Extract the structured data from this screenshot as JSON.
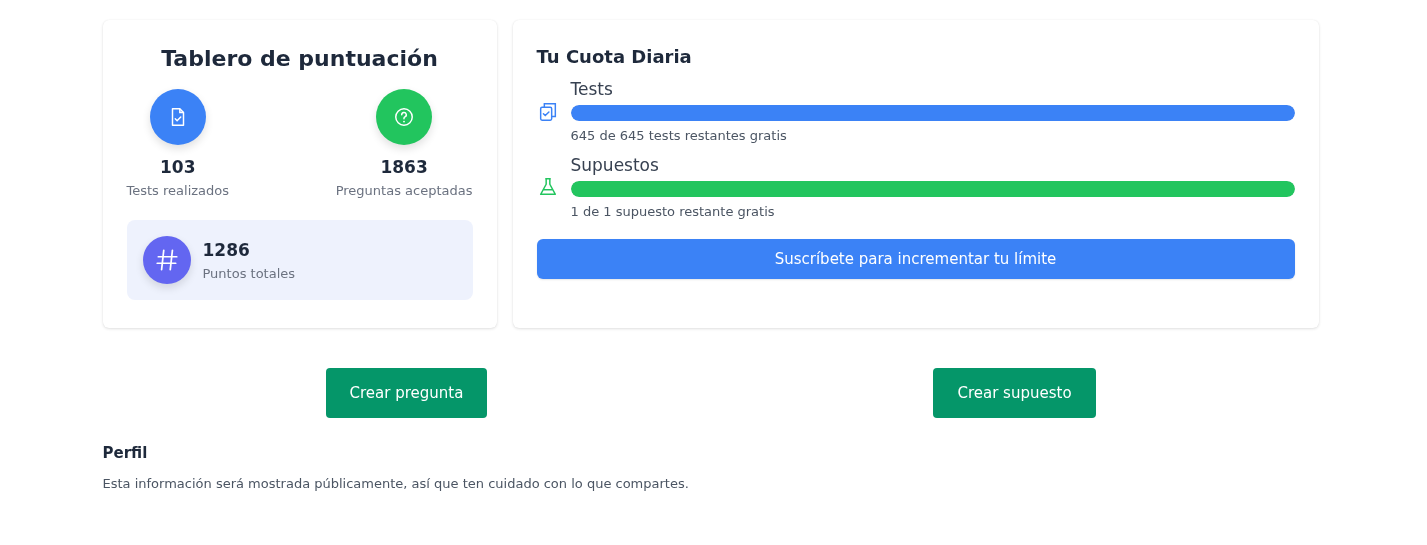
{
  "scoreboard": {
    "title": "Tablero de puntuación",
    "stats": [
      {
        "kind": "document",
        "value": "103",
        "label": "Tests realizados",
        "color": "#3b82f6"
      },
      {
        "kind": "question",
        "value": "1863",
        "label": "Preguntas aceptadas",
        "color": "#22c55e"
      }
    ],
    "total": {
      "kind": "hash",
      "value": "1286",
      "label": "Puntos totales"
    }
  },
  "quota": {
    "title": "Tu Cuota Diaria",
    "items": [
      {
        "kind": "clipboard",
        "name": "Tests",
        "level": 1,
        "color": "#3b82f6",
        "reading": "645 de 645 tests restantes gratis"
      },
      {
        "kind": "flask",
        "name": "Supuestos",
        "level": 1,
        "color": "#22c55e",
        "reading": "1 de 1 supuesto restante gratis"
      }
    ],
    "button": "Suscríbete para incrementar tu límite"
  },
  "actions": [
    "Crear pregunta",
    "Crear supuesto"
  ],
  "profile": {
    "title": "Perfil",
    "description": "Esta información será mostrada públicamente, así que ten cuidado con lo que compartes."
  }
}
